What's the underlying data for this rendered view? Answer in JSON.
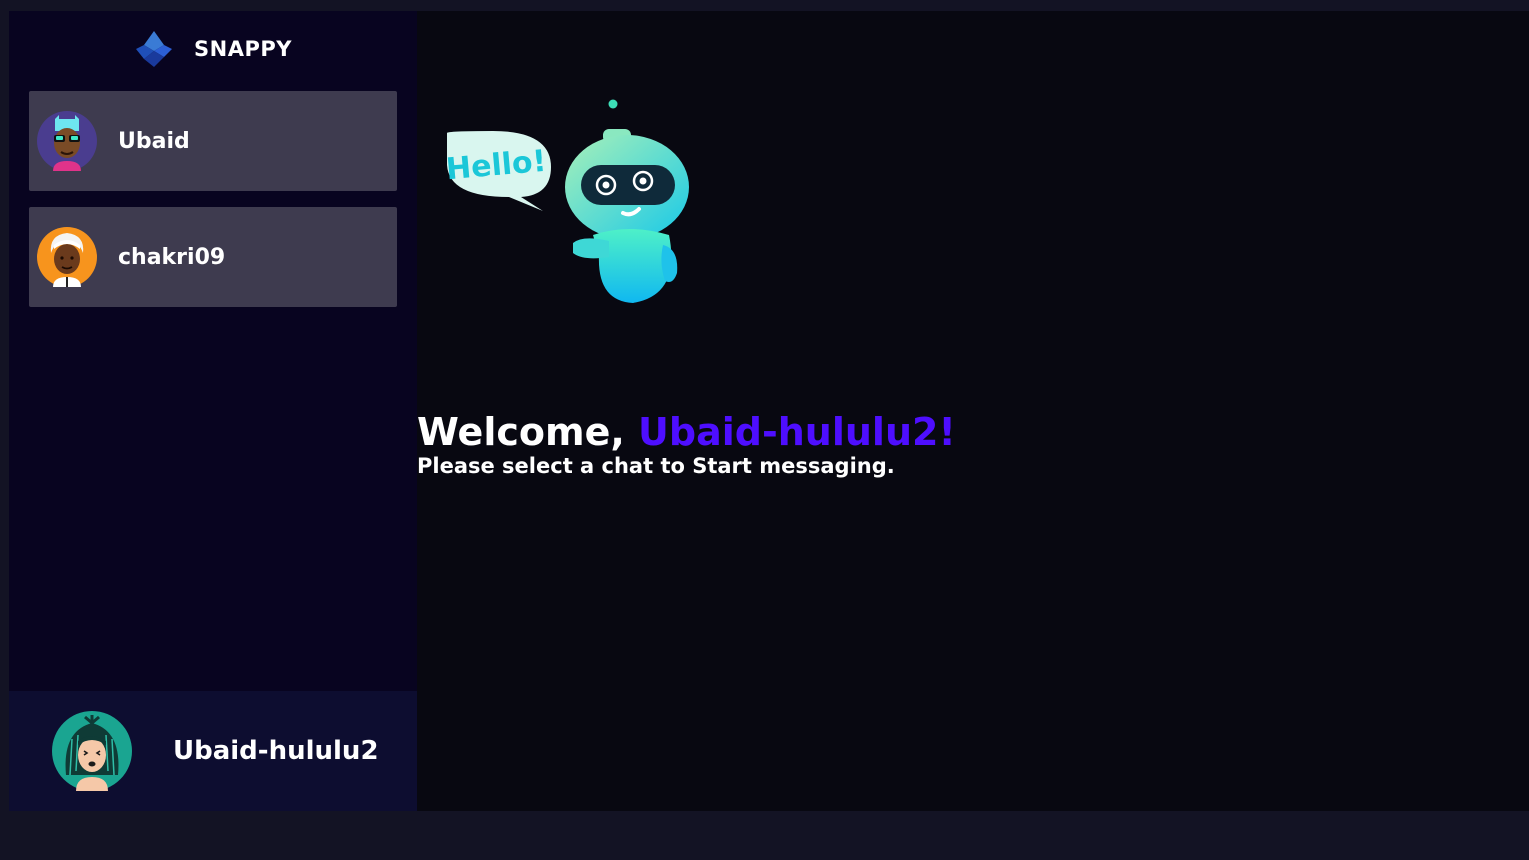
{
  "brand": {
    "name": "SNAPPY",
    "logo_icon": "snappy-logo-icon"
  },
  "contacts": [
    {
      "username": "Ubaid",
      "avatar_icon": "avatar-sunglasses-icon",
      "avatar_bg": "#4a3d8f"
    },
    {
      "username": "chakri09",
      "avatar_icon": "avatar-white-hair-icon",
      "avatar_bg": "#f7941d"
    }
  ],
  "current_user": {
    "username": "Ubaid-hululu2",
    "avatar_icon": "avatar-dreadlocks-icon",
    "avatar_bg": "#1aa591"
  },
  "welcome": {
    "greeting": "Welcome, ",
    "username": "Ubaid-hululu2",
    "exclaim": "!",
    "subtitle": "Please select a chat to Start messaging.",
    "robot_icon": "hello-robot-icon",
    "speech_text": "Hello!"
  },
  "colors": {
    "accent": "#4e0eff",
    "sidebar_bg": "#080420",
    "contact_bg": "#3e3b4f",
    "current_user_bg": "#0d0d30",
    "main_bg": "#080811",
    "page_bg": "#131324"
  }
}
